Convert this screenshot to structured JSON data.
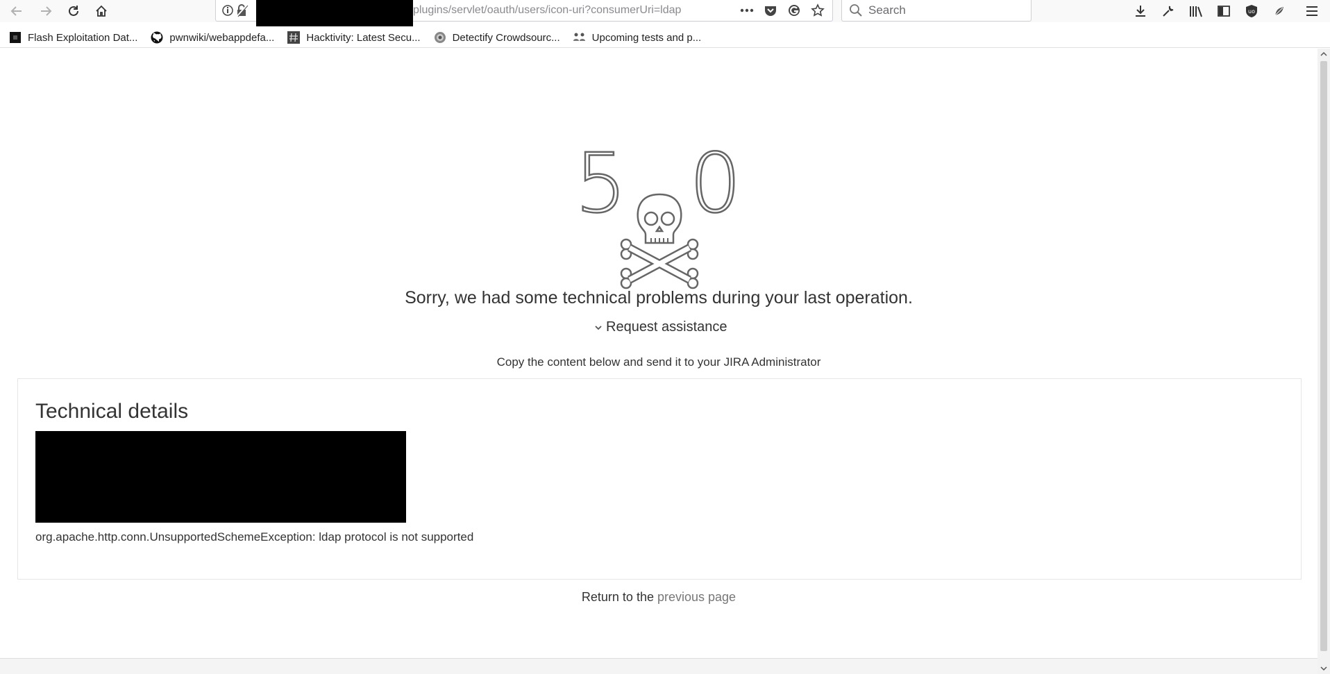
{
  "browser": {
    "url": "plugins/servlet/oauth/users/icon-uri?consumerUri=ldap",
    "search_placeholder": "Search",
    "bookmarks": [
      {
        "label": "Flash Exploitation Dat...",
        "icon": "square-icon"
      },
      {
        "label": "pwnwiki/webappdefa...",
        "icon": "github-icon"
      },
      {
        "label": "Hacktivity: Latest Secu...",
        "icon": "hash-icon"
      },
      {
        "label": "Detectify Crowdsourc...",
        "icon": "detectify-icon"
      },
      {
        "label": "Upcoming tests and p...",
        "icon": "people-icon"
      }
    ]
  },
  "page": {
    "error_code_left": "5",
    "error_code_right": "0",
    "message": "Sorry, we had some technical problems during your last operation.",
    "request_assistance": "Request assistance",
    "copy_instruction": "Copy the content below and send it to your JIRA Administrator",
    "details_title": "Technical details",
    "exception": "org.apache.http.conn.UnsupportedSchemeException: ldap protocol is not supported",
    "return_prefix": "Return to the",
    "return_link": "previous page"
  }
}
